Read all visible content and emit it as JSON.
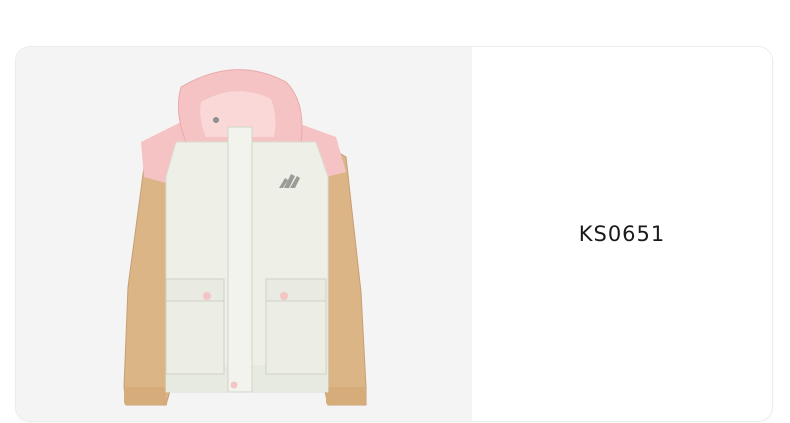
{
  "product": {
    "code": "KS0651",
    "image_icon": "jacket-product-image",
    "logo_icon": "three-stripes-logo-icon"
  },
  "colors": {
    "image_background": "#f4f4f4",
    "jacket_body": "#eef0e8",
    "jacket_pink": "#f6c3c4",
    "jacket_tan": "#dcb587",
    "text": "#1a1a1a"
  }
}
